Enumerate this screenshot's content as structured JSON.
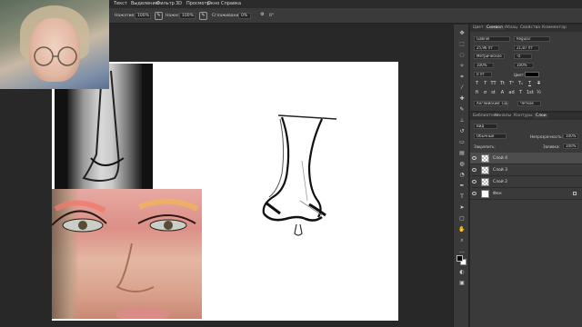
{
  "menu": [
    "Текст",
    "Выделение",
    "Фильтр",
    "3D",
    "Просмотр",
    "Окно",
    "Справка"
  ],
  "options": {
    "flow_label": "Нажатие:",
    "flow_value": "100%",
    "pressure_label": "Нажм:",
    "pressure_value": "100%",
    "smoothing_label": "Сглаживание:",
    "smoothing_value": "0%",
    "angle_value": "0°"
  },
  "character_panel": {
    "tabs": [
      "Цвет",
      "Символ",
      "Абзац",
      "Свойства",
      "Комментар"
    ],
    "active_tab": "Символ",
    "font_family": "Gabriel",
    "font_style": "Regular",
    "font_size": "25,96 пт",
    "leading": "21,87 пт",
    "kerning": "Метрическое",
    "tracking": "-0",
    "vscale": "100%",
    "hscale": "100%",
    "baseline": "0 пт",
    "color_label": "Цвет:",
    "language": "Английский: США",
    "antialias": "Чёткое"
  },
  "layers_panel": {
    "tabs": [
      "Библиотеки",
      "Каналы",
      "Контуры",
      "Слои"
    ],
    "active_tab": "Слои",
    "filter": "Вид",
    "blend_mode": "Обычные",
    "opacity_label": "Непрозрачность:",
    "opacity_value": "100%",
    "lock_label": "Закрепить:",
    "fill_label": "Заливка:",
    "fill_value": "100%",
    "layers": [
      {
        "name": "Слой 4",
        "selected": true
      },
      {
        "name": "Слой 3",
        "selected": false
      },
      {
        "name": "Слой 2",
        "selected": false
      },
      {
        "name": "Фон",
        "selected": false
      }
    ]
  },
  "toolbar_icons": [
    "move-icon",
    "marquee-icon",
    "lasso-icon",
    "magic-wand-icon",
    "crop-icon",
    "eyedropper-icon",
    "healing-icon",
    "brush-icon",
    "stamp-icon",
    "history-brush-icon",
    "eraser-icon",
    "gradient-icon",
    "blur-icon",
    "dodge-icon",
    "pen-icon",
    "type-icon",
    "path-select-icon",
    "shape-icon",
    "hand-icon",
    "zoom-icon",
    "more-icon"
  ]
}
